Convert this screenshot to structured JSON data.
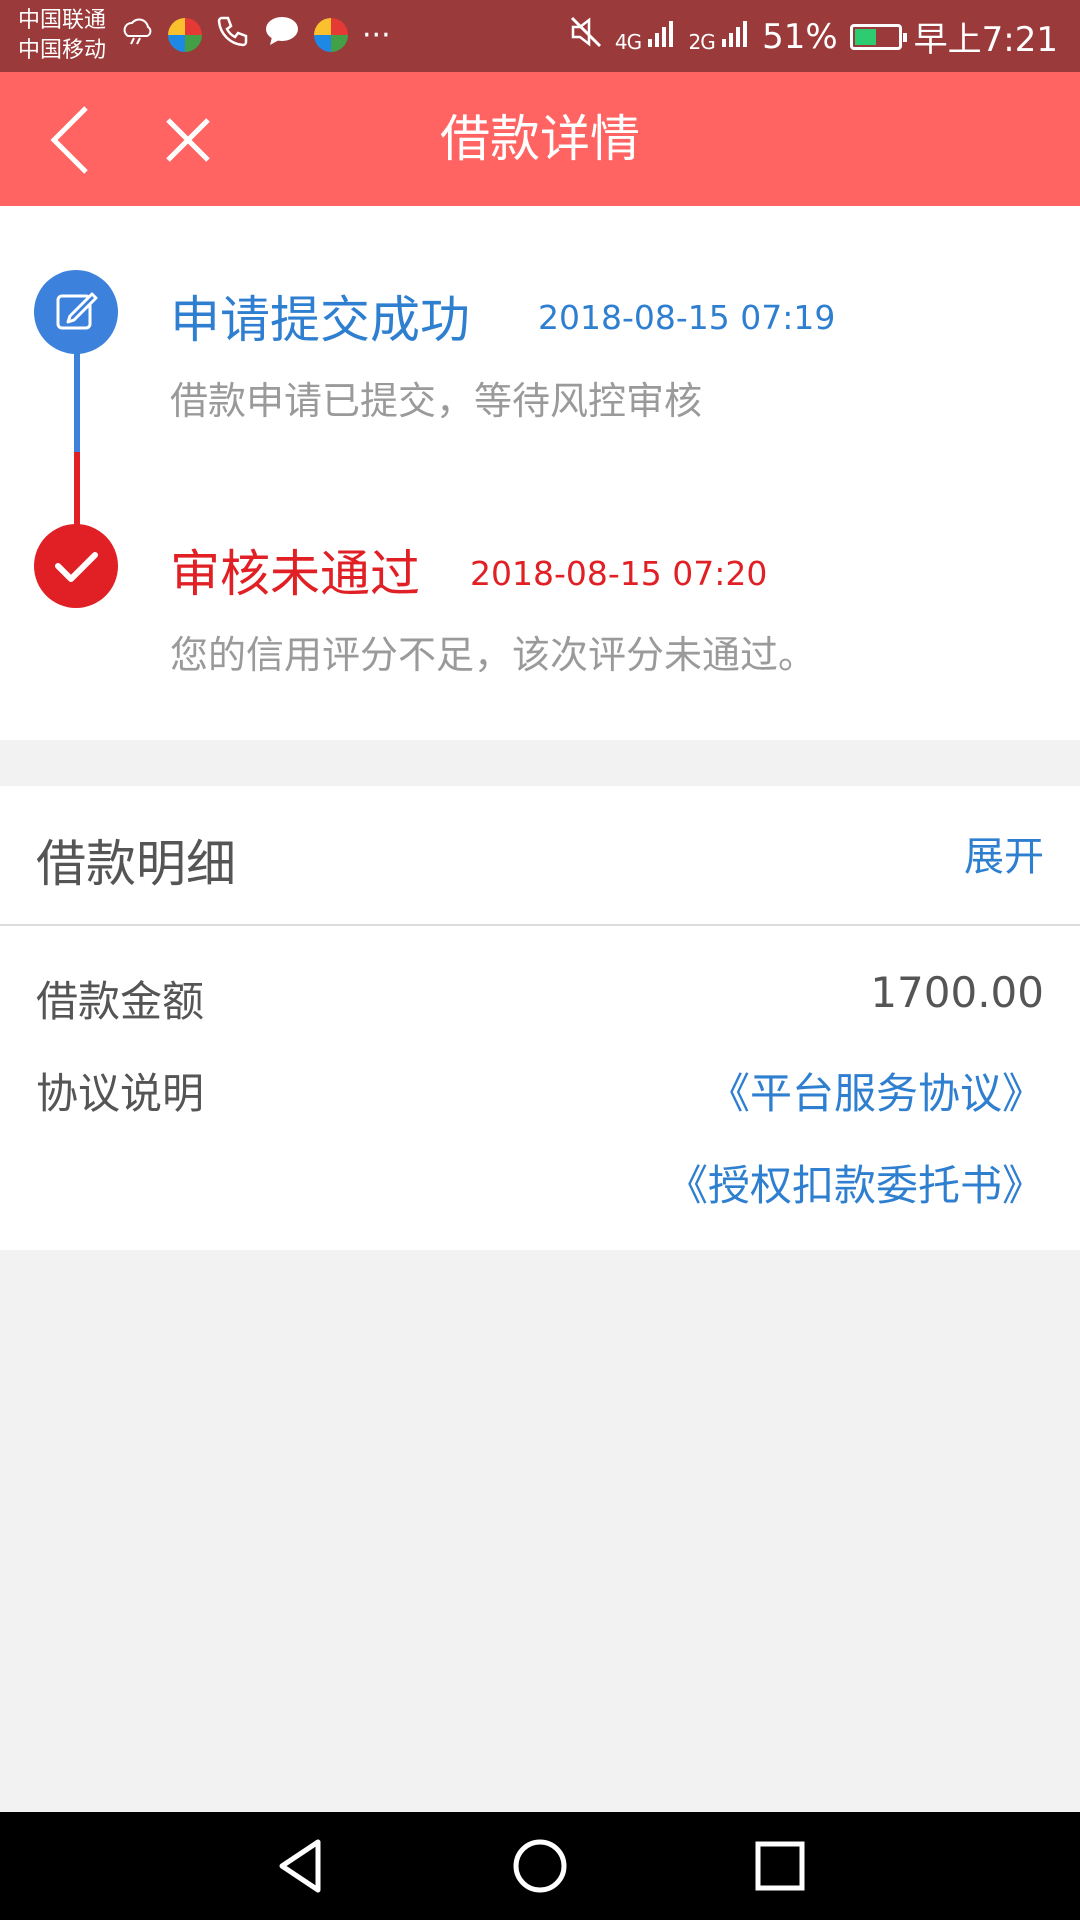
{
  "status_bar": {
    "carrier_1": "中国联通",
    "carrier_2": "中国移动",
    "more_icon": "···",
    "sig_4g": "4G",
    "sig_2g": "2G",
    "battery_percent": "51%",
    "battery_level": 0.51,
    "time": "早上7:21",
    "icons": [
      "weather-icon",
      "app-icon",
      "wifi-call-icon",
      "message-icon",
      "app-icon",
      "more-icon",
      "mute-icon",
      "signal-4g-icon",
      "signal-2g-icon",
      "battery-icon"
    ]
  },
  "header": {
    "title": "借款详情",
    "background": "#ff6462"
  },
  "timeline": {
    "steps": [
      {
        "title": "申请提交成功",
        "time": "2018-08-15 07:19",
        "description": "借款申请已提交，等待风控审核",
        "color": "#2f7fd0",
        "icon": "edit-icon"
      },
      {
        "title": "审核未通过",
        "time": "2018-08-15 07:20",
        "description": "您的信用评分不足，该次评分未通过。",
        "color": "#e02025",
        "icon": "check-icon"
      }
    ]
  },
  "details": {
    "title": "借款明细",
    "expand_label": "展开",
    "amount_label": "借款金额",
    "amount_value": "1700.00",
    "agreement_label": "协议说明",
    "agreements": [
      "《平台服务协议》",
      "《授权扣款委托书》"
    ]
  },
  "nav": {
    "icons": [
      "nav-back-icon",
      "nav-home-icon",
      "nav-recent-icon"
    ]
  }
}
